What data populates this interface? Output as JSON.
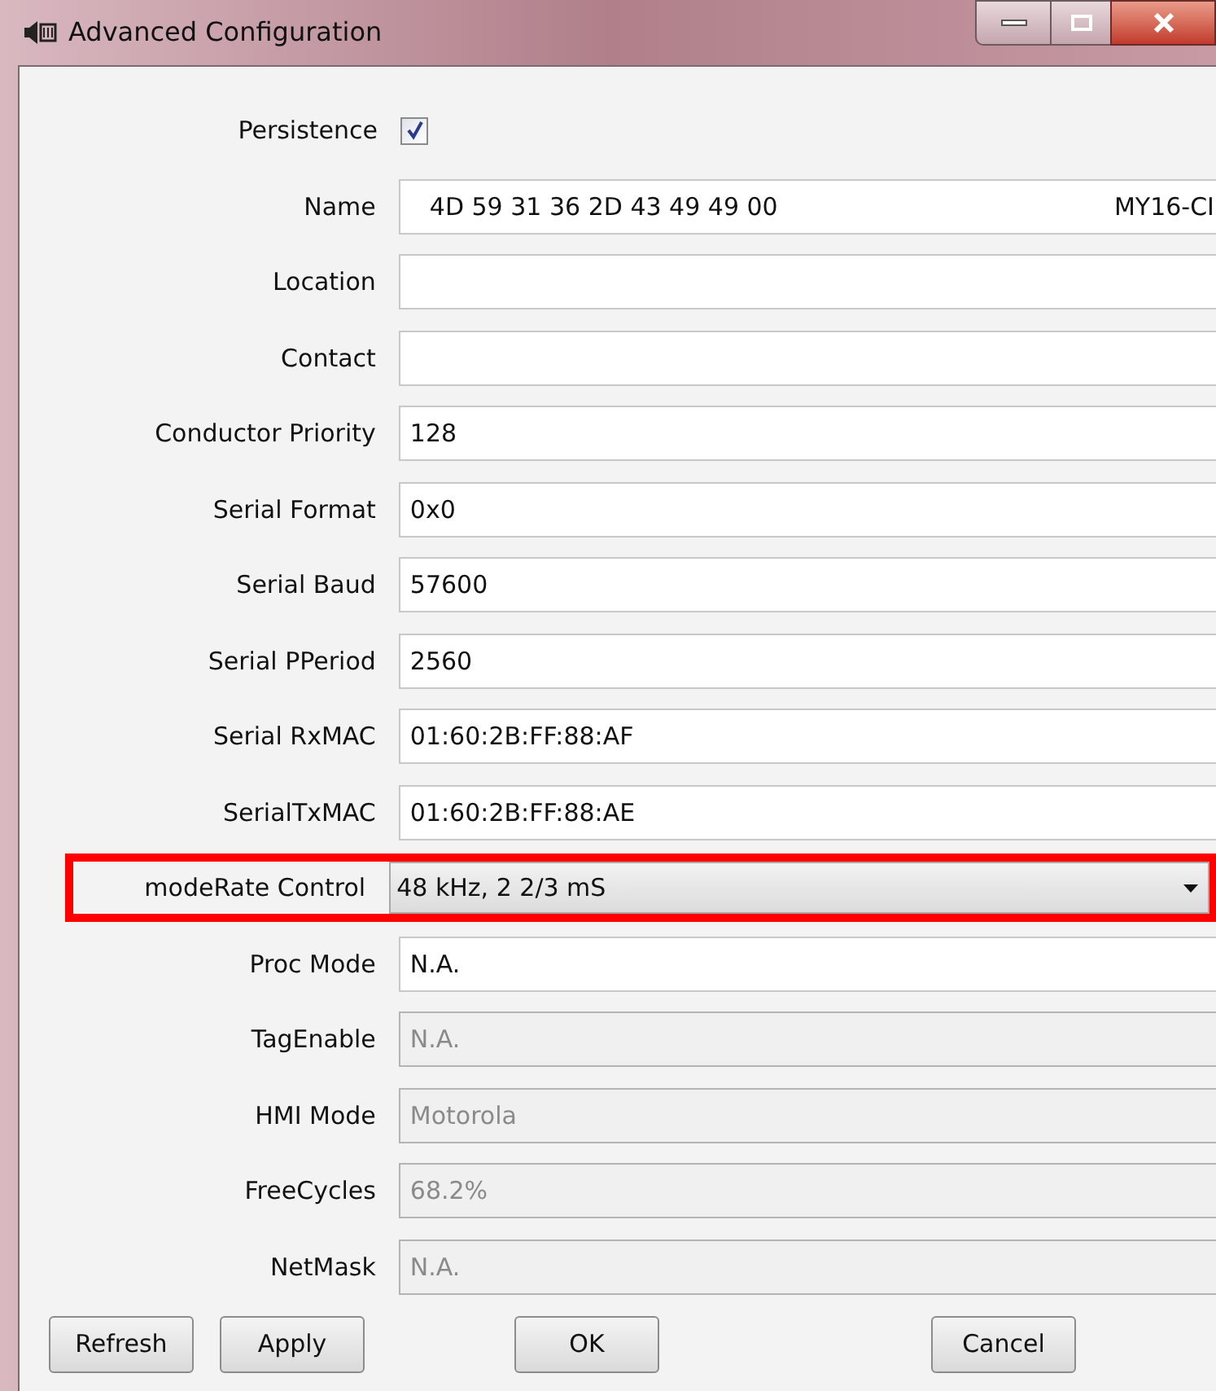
{
  "window": {
    "title": "Advanced Configuration"
  },
  "rows": [
    {
      "label": "Persistence",
      "kind": "checkbox",
      "checked": true
    },
    {
      "label": "Name",
      "kind": "text",
      "value": "4D 59 31 36 2D 43 49 49 00",
      "value_2": "MY16-CI",
      "disabled": false
    },
    {
      "label": "Location",
      "kind": "text",
      "disabled": false
    },
    {
      "label": "Contact",
      "kind": "text",
      "disabled": false
    },
    {
      "label": "Conductor Priority",
      "kind": "text",
      "value": "128",
      "disabled": false
    },
    {
      "label": "Serial Format",
      "kind": "text",
      "value": "0x0",
      "disabled": false
    },
    {
      "label": "Serial Baud",
      "kind": "text",
      "value": "57600",
      "disabled": false
    },
    {
      "label": "Serial PPeriod",
      "kind": "text",
      "value": "2560",
      "disabled": false
    },
    {
      "label": "Serial RxMAC",
      "kind": "text",
      "value": "01:60:2B:FF:88:AF",
      "disabled": false
    },
    {
      "label": "SerialTxMAC",
      "kind": "text",
      "value": "01:60:2B:FF:88:AE",
      "disabled": false
    },
    {
      "label": "modeRate Control",
      "kind": "dropdown",
      "value": "48 kHz, 2 2/3 mS",
      "highlighted": true
    },
    {
      "label": "Proc Mode",
      "kind": "text",
      "value": "N.A.",
      "disabled": false
    },
    {
      "label": "TagEnable",
      "kind": "text",
      "value": "N.A.",
      "disabled": true
    },
    {
      "label": "HMI Mode",
      "kind": "text",
      "value": "Motorola",
      "disabled": true
    },
    {
      "label": "FreeCycles",
      "kind": "text",
      "value": "68.2%",
      "disabled": true
    },
    {
      "label": "NetMask",
      "kind": "text",
      "value": "N.A.",
      "disabled": true
    }
  ],
  "buttons": [
    "Refresh",
    "Apply",
    "OK",
    "Cancel"
  ]
}
